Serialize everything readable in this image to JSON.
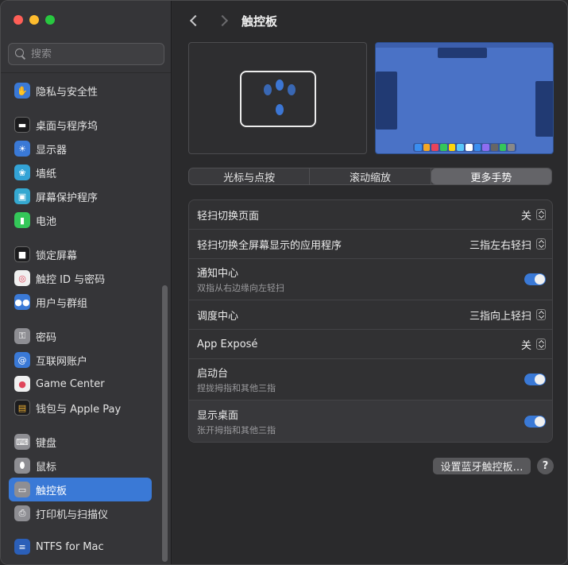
{
  "search": {
    "placeholder": "搜索"
  },
  "sidebar": {
    "items": [
      {
        "label": "隐私与安全性",
        "icon": "hand-icon",
        "color": "#3a79d6",
        "glyph": "✋"
      },
      {
        "label": "桌面与程序坞",
        "icon": "dock-icon",
        "color": "#1c1c1e",
        "glyph": "▬"
      },
      {
        "label": "显示器",
        "icon": "sun-icon",
        "color": "#3a79d6",
        "glyph": "☀"
      },
      {
        "label": "墙纸",
        "icon": "wallpaper-icon",
        "color": "#33a3d6",
        "glyph": "❀"
      },
      {
        "label": "屏幕保护程序",
        "icon": "screensaver-icon",
        "color": "#35a8d0",
        "glyph": "▣"
      },
      {
        "label": "电池",
        "icon": "battery-icon",
        "color": "#34c759",
        "glyph": "▮"
      },
      {
        "label": "锁定屏幕",
        "icon": "lock-icon",
        "color": "#1c1c1e",
        "glyph": "🔒"
      },
      {
        "label": "触控 ID 与密码",
        "icon": "fingerprint-icon",
        "color": "#f0f0f0",
        "glyph": "◎"
      },
      {
        "label": "用户与群组",
        "icon": "users-icon",
        "color": "#3a79d6",
        "glyph": "👥"
      },
      {
        "label": "密码",
        "icon": "key-icon",
        "color": "#8e8e93",
        "glyph": "⚿"
      },
      {
        "label": "互联网账户",
        "icon": "at-icon",
        "color": "#3a79d6",
        "glyph": "@"
      },
      {
        "label": "Game Center",
        "icon": "game-center-icon",
        "color": "#f0f0f0",
        "glyph": "●"
      },
      {
        "label": "钱包与 Apple Pay",
        "icon": "wallet-icon",
        "color": "#1c1c1e",
        "glyph": "▤"
      },
      {
        "label": "键盘",
        "icon": "keyboard-icon",
        "color": "#8e8e93",
        "glyph": "⌨"
      },
      {
        "label": "鼠标",
        "icon": "mouse-icon",
        "color": "#8e8e93",
        "glyph": "⬮"
      },
      {
        "label": "触控板",
        "icon": "trackpad-icon",
        "color": "#8e8e93",
        "glyph": "▭"
      },
      {
        "label": "打印机与扫描仪",
        "icon": "printer-icon",
        "color": "#8e8e93",
        "glyph": "⎙"
      },
      {
        "label": "NTFS for Mac",
        "icon": "ntfs-icon",
        "color": "#2b5fb8",
        "glyph": "≡"
      }
    ]
  },
  "header": {
    "title": "触控板"
  },
  "tabs": [
    {
      "label": "光标与点按"
    },
    {
      "label": "滚动缩放"
    },
    {
      "label": "更多手势"
    }
  ],
  "settings": {
    "rows": [
      {
        "title": "轻扫切换页面",
        "subtitle": "",
        "control": "popup",
        "value": "关"
      },
      {
        "title": "轻扫切换全屏幕显示的应用程序",
        "subtitle": "",
        "control": "popup",
        "value": "三指左右轻扫"
      },
      {
        "title": "通知中心",
        "subtitle": "双指从右边缘向左轻扫",
        "control": "toggle",
        "value": ""
      },
      {
        "title": "调度中心",
        "subtitle": "",
        "control": "popup",
        "value": "三指向上轻扫"
      },
      {
        "title": "App Exposé",
        "subtitle": "",
        "control": "popup",
        "value": "关"
      },
      {
        "title": "启动台",
        "subtitle": "捏拢拇指和其他三指",
        "control": "toggle",
        "value": ""
      },
      {
        "title": "显示桌面",
        "subtitle": "张开拇指和其他三指",
        "control": "toggle",
        "value": ""
      }
    ]
  },
  "footer": {
    "bluetooth_label": "设置蓝牙触控板…",
    "help_label": "?"
  },
  "colors": {
    "accent": "#3a79d6",
    "desktop_preview": "#4a72c6"
  }
}
